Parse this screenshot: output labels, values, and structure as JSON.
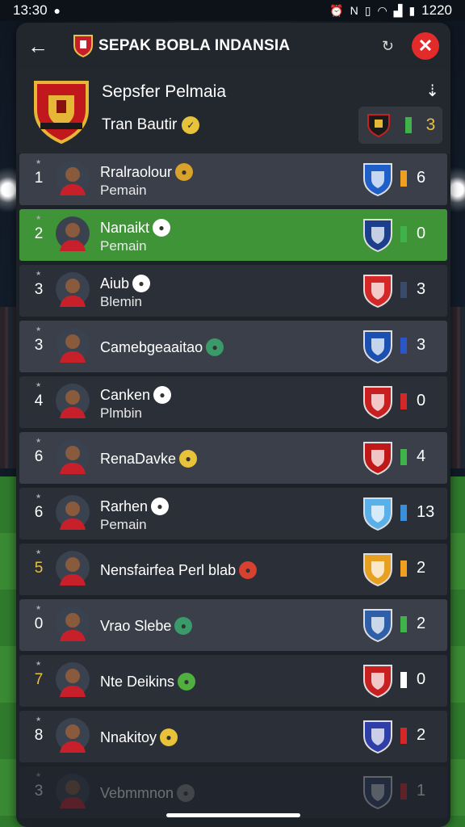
{
  "status_bar": {
    "time": "13:30",
    "right_text": "1220"
  },
  "header": {
    "title": "SEPAK BOBLA INDANSIA"
  },
  "team": {
    "name": "Sepsfer Pelmaia",
    "sub": "Tran Bautir",
    "score": "3"
  },
  "colors": {
    "panel": "#1d2128",
    "highlight": "#3f9438",
    "close": "#e32b2b",
    "accent_gold": "#e7c33a"
  },
  "rows": [
    {
      "rank": "1",
      "name": "Rralraolour",
      "role": "Pemain",
      "score": "6",
      "bar": "#f0a020",
      "club_color": "#1f5fc8",
      "badge_color": "#d8a22b"
    },
    {
      "rank": "2",
      "name": "Nanaikt",
      "role": "Pemain",
      "score": "0",
      "bar": "#3fb24a",
      "club_color": "#1b3f8a",
      "badge_color": "#ffffff"
    },
    {
      "rank": "3",
      "name": "Aiub",
      "role": "Blemin",
      "score": "3",
      "bar": "#3a4a6a",
      "club_color": "#d42828",
      "badge_color": "#ffffff"
    },
    {
      "rank": "3",
      "name": "Camebgeaaitao",
      "role": "",
      "score": "3",
      "bar": "#2a56c8",
      "club_color": "#1b4fb0",
      "badge_color": "#3a9a6a"
    },
    {
      "rank": "4",
      "name": "Canken",
      "role": "Plmbin",
      "score": "0",
      "bar": "#d42828",
      "club_color": "#c82020",
      "badge_color": "#ffffff"
    },
    {
      "rank": "6",
      "name": "RenaDavke",
      "role": "",
      "score": "4",
      "bar": "#3fb24a",
      "club_color": "#c01818",
      "badge_color": "#e8c33a"
    },
    {
      "rank": "6",
      "name": "Rarhen",
      "role": "Pemain",
      "score": "13",
      "bar": "#3a8fd8",
      "club_color": "#5ab0e8",
      "badge_color": "#ffffff"
    },
    {
      "rank": "5",
      "name": "Nensfairfea Perl blab",
      "role": "",
      "score": "2",
      "bar": "#f0a020",
      "club_color": "#e8a020",
      "badge_color": "#d84030"
    },
    {
      "rank": "0",
      "name": "Vrao Slebe",
      "role": "",
      "score": "2",
      "bar": "#3fb24a",
      "club_color": "#2f5fa8",
      "badge_color": "#3a9a6a"
    },
    {
      "rank": "7",
      "name": "Nte Deikins",
      "role": "",
      "score": "0",
      "bar": "#ffffff",
      "club_color": "#c82020",
      "badge_color": "#4fb040"
    },
    {
      "rank": "8",
      "name": "Nnakitoy",
      "role": "",
      "score": "2",
      "bar": "#d42828",
      "club_color": "#2f3fa8",
      "badge_color": "#e8c33a"
    },
    {
      "rank": "3",
      "name": "Vebmmnon",
      "role": "",
      "score": "1",
      "bar": "#d42828",
      "club_color": "#2f3f68",
      "badge_color": "#888888"
    }
  ]
}
